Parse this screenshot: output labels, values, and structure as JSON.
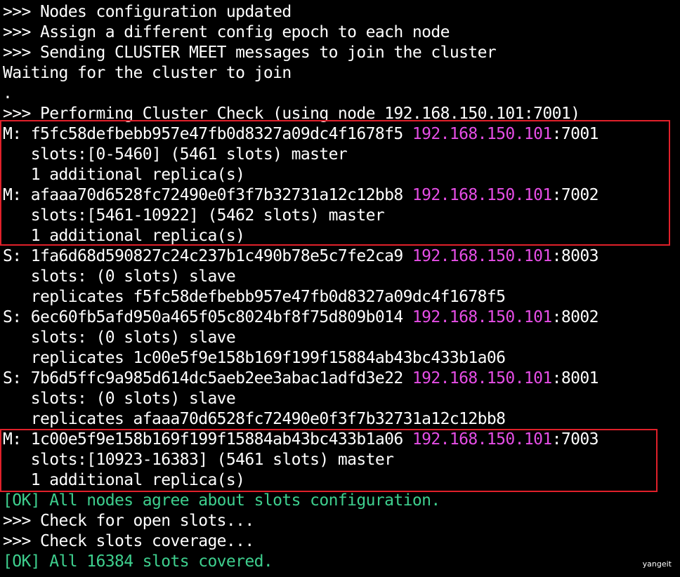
{
  "colors": {
    "background": "#000000",
    "text": "#ffffff",
    "ip_highlight": "#e64ee6",
    "ok_green": "#3ecf8e",
    "highlight_box": "#e0202a"
  },
  "lines": {
    "l1": ">>> Nodes configuration updated",
    "l2": ">>> Assign a different config epoch to each node",
    "l3": ">>> Sending CLUSTER MEET messages to join the cluster",
    "l4": "Waiting for the cluster to join",
    "l5": ".",
    "l6": ">>> Performing Cluster Check (using node 192.168.150.101:7001)",
    "m1_prefix": "M: f5fc58defbebb957e47fb0d8327a09dc4f1678f5 ",
    "m1_ip": "192.168.150.101",
    "m1_port": ":7001",
    "m1_slots": "   slots:[0-5460] (5461 slots) master",
    "m1_replica": "   1 additional replica(s)",
    "m2_prefix": "M: afaaa70d6528fc72490e0f3f7b32731a12c12bb8 ",
    "m2_ip": "192.168.150.101",
    "m2_port": ":7002",
    "m2_slots": "   slots:[5461-10922] (5462 slots) master",
    "m2_replica": "   1 additional replica(s)",
    "s1_prefix": "S: 1fa6d68d590827c24c237b1c490b78e5c7fe2ca9 ",
    "s1_ip": "192.168.150.101",
    "s1_port": ":8003",
    "s1_slots": "   slots: (0 slots) slave",
    "s1_replicates": "   replicates f5fc58defbebb957e47fb0d8327a09dc4f1678f5",
    "s2_prefix": "S: 6ec60fb5afd950a465f05c8024bf8f75d809b014 ",
    "s2_ip": "192.168.150.101",
    "s2_port": ":8002",
    "s2_slots": "   slots: (0 slots) slave",
    "s2_replicates": "   replicates 1c00e5f9e158b169f199f15884ab43bc433b1a06",
    "s3_prefix": "S: 7b6d5ffc9a985d614dc5aeb2ee3abac1adfd3e22 ",
    "s3_ip": "192.168.150.101",
    "s3_port": ":8001",
    "s3_slots": "   slots: (0 slots) slave",
    "s3_replicates": "   replicates afaaa70d6528fc72490e0f3f7b32731a12c12bb8",
    "m3_prefix": "M: 1c00e5f9e158b169f199f15884ab43bc433b1a06 ",
    "m3_ip": "192.168.150.101",
    "m3_port": ":7003",
    "m3_slots": "   slots:[10923-16383] (5461 slots) master",
    "m3_replica": "   1 additional replica(s)",
    "ok1": "[OK] All nodes agree about slots configuration.",
    "check_open": ">>> Check for open slots...",
    "check_cov": ">>> Check slots coverage...",
    "ok2": "[OK] All 16384 slots covered."
  },
  "watermark": "yangeit"
}
